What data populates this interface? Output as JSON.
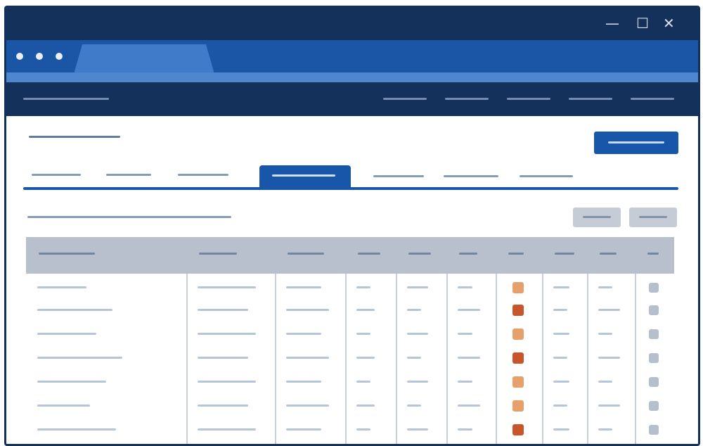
{
  "window": {
    "controls": {
      "minimize": "—",
      "maximize": "☐",
      "close": "✕"
    }
  },
  "icons": {
    "minimize": "minimize-icon",
    "maximize": "maximize-icon",
    "close": "close-icon"
  },
  "colors": {
    "titlebar": "#13315a",
    "tabbar": "#1a55a6",
    "accent": "#1756a8",
    "status_light": "#e8a06a",
    "status_dark": "#c9552a",
    "header_bg": "#b7c0cc"
  },
  "table": {
    "rows": [
      {
        "status": "light"
      },
      {
        "status": "dark"
      },
      {
        "status": "light"
      },
      {
        "status": "dark"
      },
      {
        "status": "light"
      },
      {
        "status": "light"
      },
      {
        "status": "dark"
      }
    ]
  }
}
